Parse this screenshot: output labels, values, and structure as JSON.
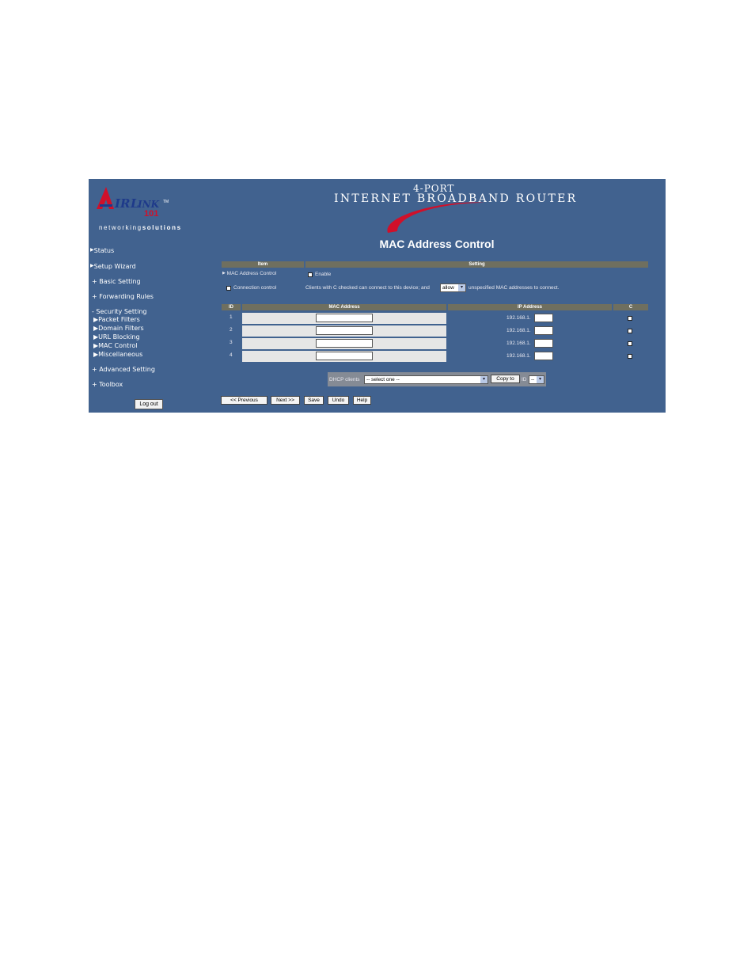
{
  "brand": {
    "logo_text": "AIRLINK 101",
    "tagline_prefix": "networking",
    "tagline_suffix": "solutions",
    "banner_top": "4-PORT",
    "banner_main": "INTERNET BROADBAND ROUTER"
  },
  "sidebar": {
    "status": "Status",
    "setup_wizard": "Setup Wizard",
    "basic_setting": "+ Basic Setting",
    "forwarding_rules": "+ Forwarding Rules",
    "security_setting": "- Security Setting",
    "security_items": [
      "Packet Filters",
      "Domain Filters",
      "URL Blocking",
      "MAC Control",
      "Miscellaneous"
    ],
    "advanced_setting": "+ Advanced Setting",
    "toolbox": "+ Toolbox",
    "logout": "Log out"
  },
  "main": {
    "title": "MAC Address Control",
    "header_item": "Item",
    "header_setting": "Setting",
    "mac_control_label": "MAC Address Control",
    "enable_label": "Enable",
    "connection_control_label": "Connection control",
    "connection_text_before": "Clients with C checked can connect to this device; and",
    "connection_select": "allow",
    "connection_text_after": "unspecified MAC addresses to connect.",
    "table_headers": {
      "id": "ID",
      "mac": "MAC Address",
      "ip": "IP Address",
      "c": "C"
    },
    "rows": [
      {
        "id": "1",
        "ip_prefix": "192.168.1."
      },
      {
        "id": "2",
        "ip_prefix": "192.168.1."
      },
      {
        "id": "3",
        "ip_prefix": "192.168.1."
      },
      {
        "id": "4",
        "ip_prefix": "192.168.1."
      }
    ],
    "dhcp_label": "DHCP clients",
    "dhcp_select": "-- select one --",
    "copy_to": "Copy to",
    "id_label": "ID",
    "id_select": "--",
    "buttons": {
      "previous": "<< Previous",
      "next": "Next >>",
      "save": "Save",
      "undo": "Undo",
      "help": "Help"
    }
  },
  "colors": {
    "frame_bg": "#41628f",
    "header_bg": "#6f6f5f",
    "swoosh": "#d0102a"
  }
}
